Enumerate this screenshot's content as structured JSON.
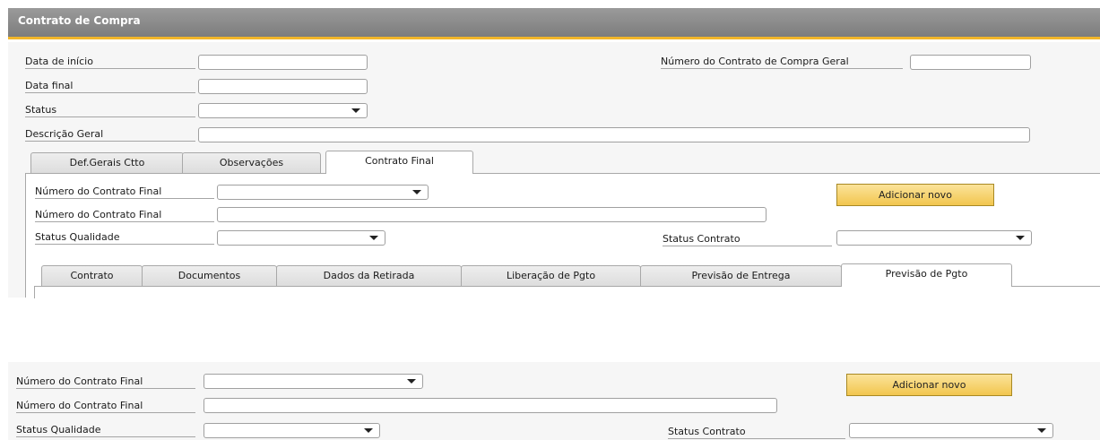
{
  "window": {
    "title": "Contrato de Compra"
  },
  "header_fields": {
    "start_date": {
      "label": "Data de início",
      "value": ""
    },
    "end_date": {
      "label": "Data final",
      "value": ""
    },
    "status": {
      "label": "Status",
      "value": ""
    },
    "description": {
      "label": "Descrição Geral",
      "value": ""
    },
    "general_contract_number": {
      "label": "Número do Contrato de Compra Geral",
      "value": ""
    }
  },
  "main_tabs": [
    {
      "label": "Def.Gerais Ctto",
      "active": false
    },
    {
      "label": "Observações",
      "active": false
    },
    {
      "label": "Contrato Final",
      "active": true
    }
  ],
  "final_contract": {
    "number_select": {
      "label": "Número do Contrato Final",
      "value": ""
    },
    "number_text": {
      "label": "Número do Contrato Final",
      "value": ""
    },
    "quality_status": {
      "label": "Status Qualidade",
      "value": ""
    },
    "contract_status": {
      "label": "Status Contrato",
      "value": ""
    },
    "add_button": "Adicionar novo"
  },
  "sub_tabs": [
    {
      "label": "Contrato",
      "active": false
    },
    {
      "label": "Documentos",
      "active": false
    },
    {
      "label": "Dados da Retirada",
      "active": false
    },
    {
      "label": "Liberação de Pgto",
      "active": false
    },
    {
      "label": "Previsão de Entrega",
      "active": false
    },
    {
      "label": "Previsão de Pgto",
      "active": true
    }
  ],
  "zoom_panel": {
    "number_select": {
      "label": "Número do Contrato Final",
      "value": ""
    },
    "number_text": {
      "label": "Número do Contrato Final",
      "value": ""
    },
    "quality_status": {
      "label": "Status Qualidade",
      "value": ""
    },
    "contract_status": {
      "label": "Status Contrato",
      "value": ""
    },
    "add_button": "Adicionar novo"
  },
  "colors": {
    "accent": "#f2b62a",
    "titlebar": "#8a8a8a",
    "button": "#f6d06a"
  },
  "icons": {
    "dropdown": "chevron-down-icon"
  }
}
